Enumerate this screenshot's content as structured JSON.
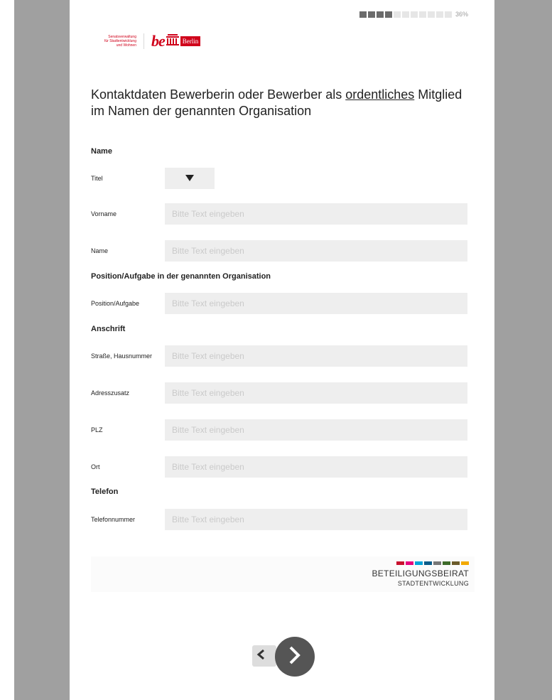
{
  "progress": {
    "filled_segments": 4,
    "total_segments": 11,
    "label": "36%"
  },
  "logo": {
    "senat_text_1": "Senatsverwaltung",
    "senat_text_2": "für Stadtentwicklung",
    "senat_text_3": "und Wohnen",
    "be": "be",
    "berlin": "Berlin"
  },
  "heading": {
    "part1": "Kontaktdaten Bewerberin oder Bewerber als ",
    "underlined": "ordentliches",
    "part2": " Mitglied im Namen der genannten Organisation"
  },
  "sections": {
    "name": "Name",
    "position": "Position/Aufgabe in der genannten Organisation",
    "anschrift": "Anschrift",
    "telefon": "Telefon"
  },
  "fields": {
    "placeholder": "Bitte Text eingeben",
    "titel": "Titel",
    "vorname": "Vorname",
    "name": "Name",
    "position": "Position/Aufgabe",
    "strasse": "Straße, Hausnummer",
    "adresszusatz": "Adresszusatz",
    "plz": "PLZ",
    "ort": "Ort",
    "telefonnummer": "Telefonnummer"
  },
  "footer": {
    "line1": "BETEILIGUNGSBEIRAT",
    "line2": "STADTENTWICKLUNG",
    "bar_colors": [
      "#c8102e",
      "#e6007e",
      "#00a3d9",
      "#0a5c8a",
      "#777777",
      "#3d6b2a",
      "#6b5b2a",
      "#f2a900"
    ]
  },
  "colors": {
    "accent": "#d0021b",
    "nav": "#555555"
  }
}
